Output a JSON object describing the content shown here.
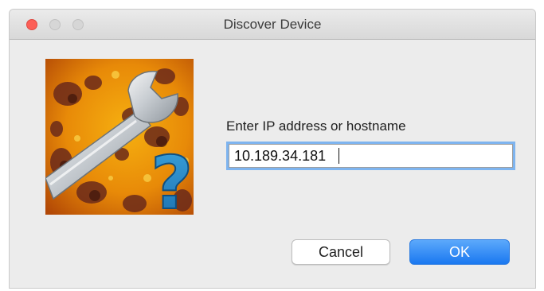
{
  "window": {
    "title": "Discover Device"
  },
  "dialog": {
    "prompt": "Enter IP address or hostname",
    "ip_value": "10.189.34.181",
    "cancel_label": "Cancel",
    "ok_label": "OK"
  },
  "icons": {
    "app_icon": "wrench-question-icon",
    "close": "close-icon",
    "minimize": "minimize-icon",
    "zoom": "zoom-icon"
  },
  "colors": {
    "close_button": "#fc5f57",
    "focus_ring": "#7eb4ef",
    "ok_button": "#1a78f0",
    "window_background": "#ececec"
  }
}
